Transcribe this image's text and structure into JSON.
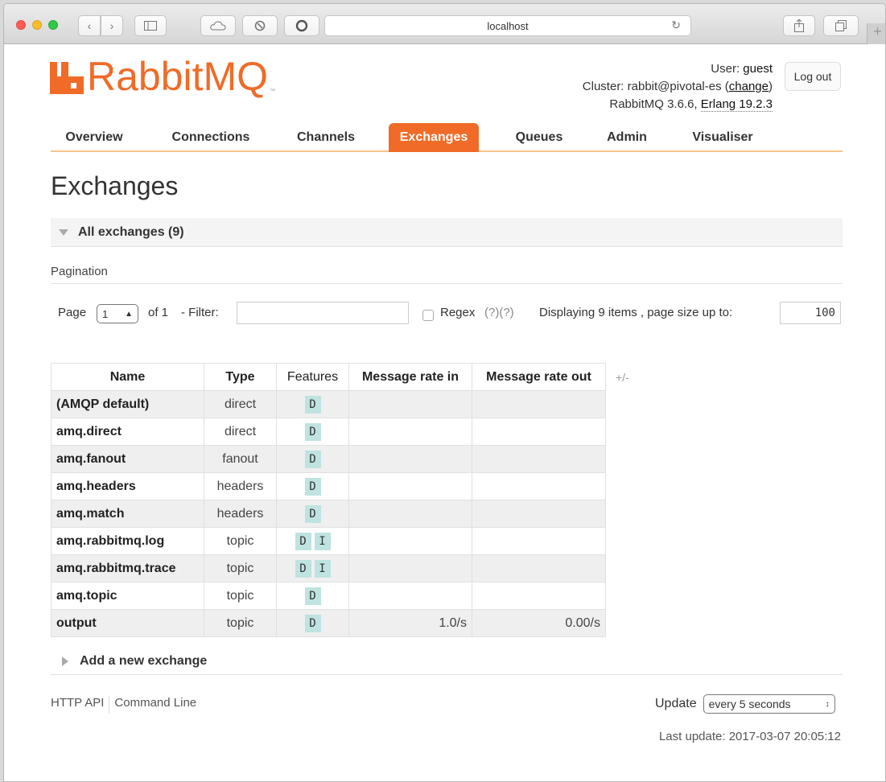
{
  "browser": {
    "address": "localhost"
  },
  "header": {
    "logo_text": "RabbitMQ",
    "user_label": "User:",
    "user_name": "guest",
    "cluster_label": "Cluster:",
    "cluster_name": "rabbit@pivotal-es",
    "change_link": "change",
    "version": "RabbitMQ 3.6.6,",
    "erlang": "Erlang 19.2.3",
    "logout_label": "Log out"
  },
  "nav": {
    "tabs": [
      "Overview",
      "Connections",
      "Channels",
      "Exchanges",
      "Queues",
      "Admin",
      "Visualiser"
    ],
    "active": "Exchanges"
  },
  "page_title": "Exchanges",
  "section": {
    "title": "All exchanges (9)"
  },
  "pagination": {
    "label": "Pagination",
    "page_label": "Page",
    "page_value": "1",
    "of_label": "of 1",
    "filter_label": "- Filter:",
    "filter_value": "",
    "regex_label": "Regex",
    "regex_help": "(?)(?)",
    "displaying": "Displaying 9 items , page size up to:",
    "page_size": "100"
  },
  "table": {
    "columns": [
      "Name",
      "Type",
      "Features",
      "Message rate in",
      "Message rate out"
    ],
    "toggle": "+/-",
    "rows": [
      {
        "name": "(AMQP default)",
        "type": "direct",
        "features": [
          "D"
        ],
        "rate_in": "",
        "rate_out": ""
      },
      {
        "name": "amq.direct",
        "type": "direct",
        "features": [
          "D"
        ],
        "rate_in": "",
        "rate_out": ""
      },
      {
        "name": "amq.fanout",
        "type": "fanout",
        "features": [
          "D"
        ],
        "rate_in": "",
        "rate_out": ""
      },
      {
        "name": "amq.headers",
        "type": "headers",
        "features": [
          "D"
        ],
        "rate_in": "",
        "rate_out": ""
      },
      {
        "name": "amq.match",
        "type": "headers",
        "features": [
          "D"
        ],
        "rate_in": "",
        "rate_out": ""
      },
      {
        "name": "amq.rabbitmq.log",
        "type": "topic",
        "features": [
          "D",
          "I"
        ],
        "rate_in": "",
        "rate_out": ""
      },
      {
        "name": "amq.rabbitmq.trace",
        "type": "topic",
        "features": [
          "D",
          "I"
        ],
        "rate_in": "",
        "rate_out": ""
      },
      {
        "name": "amq.topic",
        "type": "topic",
        "features": [
          "D"
        ],
        "rate_in": "",
        "rate_out": ""
      },
      {
        "name": "output",
        "type": "topic",
        "features": [
          "D"
        ],
        "rate_in": "1.0/s",
        "rate_out": "0.00/s"
      }
    ]
  },
  "add_exchange": {
    "title": "Add a new exchange"
  },
  "footer": {
    "http_api": "HTTP API",
    "command_line": "Command Line",
    "update_label": "Update",
    "update_value": "every 5 seconds",
    "last_update": "Last update: 2017-03-07 20:05:12"
  },
  "colors": {
    "brand": "#f06b28",
    "feature_badge": "#bfe3e0"
  }
}
